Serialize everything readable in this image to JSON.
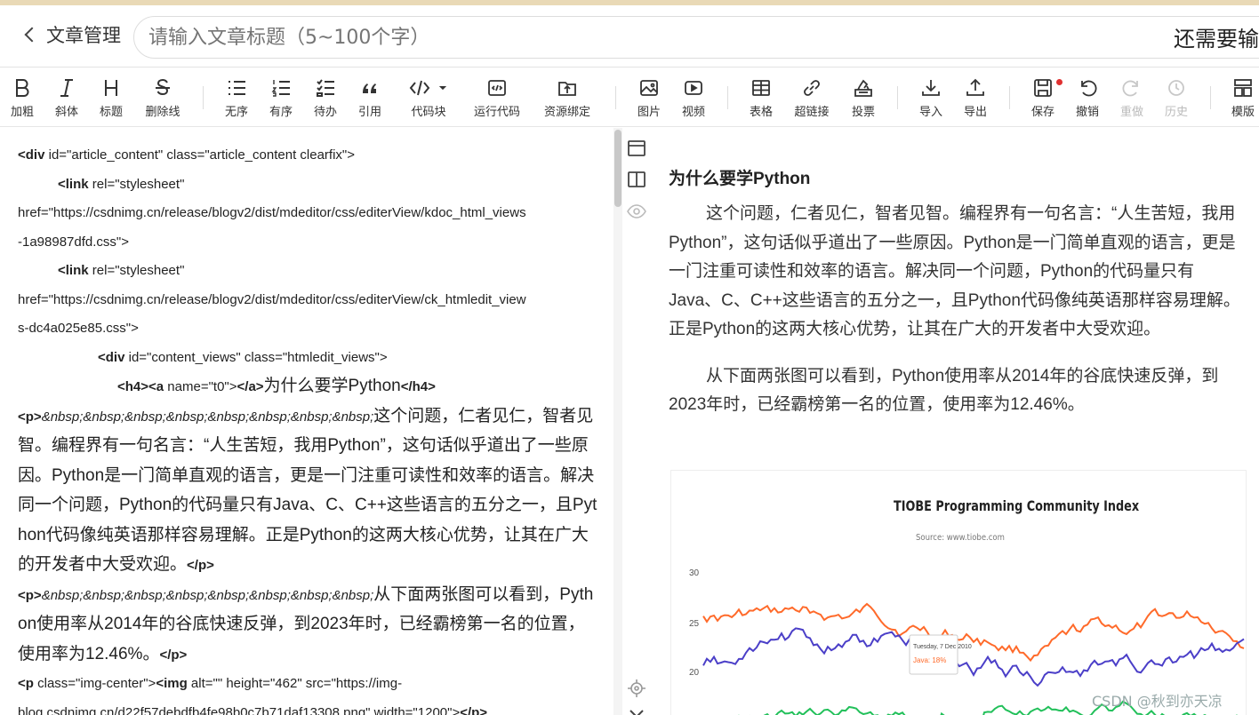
{
  "header": {
    "back_label": "文章管理",
    "title_placeholder": "请输入文章标题（5~100个字）",
    "hint": "还需要输"
  },
  "toolbar": {
    "items": [
      {
        "label": "加粗",
        "icon": "bold-icon"
      },
      {
        "label": "斜体",
        "icon": "italic-icon"
      },
      {
        "label": "标题",
        "icon": "heading-icon"
      },
      {
        "label": "删除线",
        "icon": "strikethrough-icon"
      },
      {
        "label": "无序",
        "icon": "unordered-list-icon"
      },
      {
        "label": "有序",
        "icon": "ordered-list-icon"
      },
      {
        "label": "待办",
        "icon": "todo-list-icon"
      },
      {
        "label": "引用",
        "icon": "quote-icon"
      },
      {
        "label": "代码块",
        "icon": "code-block-icon"
      },
      {
        "label": "运行代码",
        "icon": "run-code-icon"
      },
      {
        "label": "资源绑定",
        "icon": "resource-bind-icon"
      },
      {
        "label": "图片",
        "icon": "image-icon"
      },
      {
        "label": "视频",
        "icon": "video-icon"
      },
      {
        "label": "表格",
        "icon": "table-icon"
      },
      {
        "label": "超链接",
        "icon": "link-icon"
      },
      {
        "label": "投票",
        "icon": "vote-icon"
      },
      {
        "label": "导入",
        "icon": "import-icon"
      },
      {
        "label": "导出",
        "icon": "export-icon"
      },
      {
        "label": "保存",
        "icon": "save-icon"
      },
      {
        "label": "撤销",
        "icon": "undo-icon"
      },
      {
        "label": "重做",
        "icon": "redo-icon"
      },
      {
        "label": "历史",
        "icon": "history-icon"
      },
      {
        "label": "模版",
        "icon": "template-icon"
      }
    ]
  },
  "source": {
    "l1_tag": "<div",
    "l1_attrs": " id=\"article_content\" class=\"article_content clearfix\">",
    "l2_tag": "<link",
    "l2_attrs": " rel=\"stylesheet\"",
    "l3": "href=\"https://csdnimg.cn/release/blogv2/dist/mdeditor/css/editerView/kdoc_html_views",
    "l4": "-1a98987dfd.css\">",
    "l5_tag": "<link",
    "l5_attrs": " rel=\"stylesheet\"",
    "l6": "href=\"https://csdnimg.cn/release/blogv2/dist/mdeditor/css/editerView/ck_htmledit_view",
    "l7": "s-dc4a025e85.css\">",
    "l8_tag": "<div",
    "l8_attrs": " id=\"content_views\" class=\"htmledit_views\">",
    "l9_open": "<h4><a",
    "l9_attrs": " name=\"t0\">",
    "l9_close_a": "</a>",
    "l9_text": "为什么要学Python",
    "l9_close": "</h4>",
    "p1_open": "<p>",
    "p1_nbsp": "&nbsp;&nbsp;&nbsp;&nbsp;&nbsp;&nbsp;&nbsp;&nbsp;",
    "p1_text": "这个问题，仁者见仁，智者见智。编程界有一句名言：“人生苦短，我用Python”，这句话似乎道出了一些原因。Python是一门简单直观的语言，更是一门注重可读性和效率的语言。解决同一个问题，Python的代码量只有Java、C、C++这些语言的五分之一，且Python代码像纯英语那样容易理解。正是Python的这两大核心优势，让其在广大的开发者中大受欢迎。",
    "p_close": "</p>",
    "p2_text": "从下面两张图可以看到，Python使用率从2014年的谷底快速反弹，到2023年时，已经霸榜第一名的位置，使用率为12.46%。",
    "p3_open": "<p",
    "p3_attrs": " class=\"img-center\">",
    "p3_img": "<img",
    "p3_img_attrs": " alt=\"\" height=\"462\" src=\"https://img-",
    "p3_line2": "blog.csdnimg.cn/d22f57debdfb4fe98b0c7b71daf13308.png\" width=\"1200\">"
  },
  "preview": {
    "heading": "为什么要学Python",
    "p1": "这个问题，仁者见仁，智者见智。编程界有一句名言：“人生苦短，我用Python”，这句话似乎道出了一些原因。Python是一门简单直观的语言，更是一门注重可读性和效率的语言。解决同一个问题，Python的代码量只有Java、C、C++这些语言的五分之一，且Python代码像纯英语那样容易理解。正是Python的这两大核心优势，让其在广大的开发者中大受欢迎。",
    "p2": "从下面两张图可以看到，Python使用率从2014年的谷底快速反弹，到2023年时，已经霸榜第一名的位置，使用率为12.46%。"
  },
  "chart_data": {
    "type": "line",
    "title": "TIOBE Programming Community Index",
    "subtitle": "Source: www.tiobe.com",
    "y_ticks": [
      "30",
      "25",
      "20"
    ],
    "tooltip_date": "Tuesday, 7 Dec 2010",
    "tooltip_value": "Java: 18%",
    "colors": {
      "java": "#ff6a2a",
      "c": "#4b3fc8",
      "other": "#22c05a"
    }
  },
  "watermark": "CSDN @秋到亦天凉",
  "colors": {
    "save_dot": "#e03030",
    "border": "#dddddd"
  }
}
